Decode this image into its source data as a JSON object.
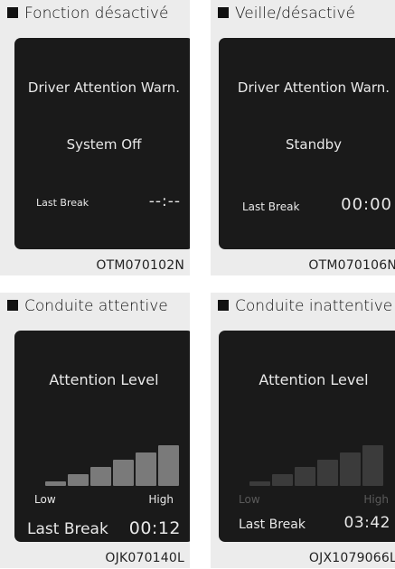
{
  "panels": [
    {
      "caption": "Fonction désactivé",
      "code": "OTM070102N",
      "screen": {
        "title": "Driver Attention Warn.",
        "state": "System Off",
        "last_break_label": "Last Break",
        "last_break_value": "--:--"
      }
    },
    {
      "caption": "Veille/désactivé",
      "code": "OTM070106N",
      "screen": {
        "title": "Driver Attention Warn.",
        "state": "Standby",
        "last_break_label": "Last Break",
        "last_break_value": "00:00"
      }
    },
    {
      "caption": "Conduite attentive",
      "code": "OJK070140L",
      "screen": {
        "title": "Attention Level",
        "low_label": "Low",
        "high_label": "High",
        "last_break_label": "Last Break",
        "last_break_value": "00:12",
        "level_fraction": 1.0,
        "bar_color": "#7a7a7a"
      }
    },
    {
      "caption": "Conduite inattentive",
      "code": "OJX1079066L",
      "screen": {
        "title": "Attention Level",
        "low_label": "Low",
        "high_label": "High",
        "last_break_label": "Last Break",
        "last_break_value": "03:42",
        "level_fraction": 0.0,
        "bar_color": "#3b3b3b"
      }
    }
  ]
}
